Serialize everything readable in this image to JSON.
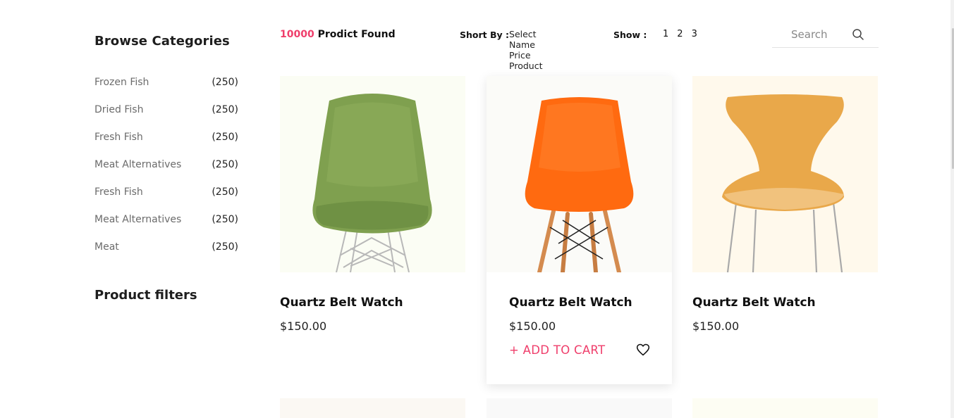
{
  "sidebar": {
    "title": "Browse Categories",
    "categories": [
      {
        "name": "Frozen Fish",
        "count": "(250)"
      },
      {
        "name": "Dried Fish",
        "count": "(250)"
      },
      {
        "name": "Fresh Fish",
        "count": "(250)"
      },
      {
        "name": "Meat Alternatives",
        "count": "(250)"
      },
      {
        "name": "Fresh Fish",
        "count": "(250)"
      },
      {
        "name": "Meat Alternatives",
        "count": "(250)"
      },
      {
        "name": "Meat",
        "count": "(250)"
      }
    ],
    "filters_title": "Product filters"
  },
  "toolbar": {
    "found_count": "10000",
    "found_label": "Prodict Found",
    "sort_label": "Short By :",
    "sort_options": [
      "Select",
      "Name",
      "Price",
      "Product"
    ],
    "show_label": "Show :",
    "pages": [
      "1",
      "2",
      "3"
    ],
    "search_placeholder": "Search"
  },
  "products": [
    {
      "title": "Quartz Belt Watch",
      "price": "$150.00",
      "image": "green-chair"
    },
    {
      "title": "Quartz Belt Watch",
      "price": "$150.00",
      "image": "orange-chair",
      "add_to_cart": "+ ADD TO CART"
    },
    {
      "title": "Quartz Belt Watch",
      "price": "$150.00",
      "image": "yellow-chair"
    }
  ],
  "colors": {
    "accent": "#ef3e6b",
    "green_chair": "#7fa04f",
    "orange_chair": "#ff6a10",
    "yellow_chair": "#e9a84a"
  }
}
